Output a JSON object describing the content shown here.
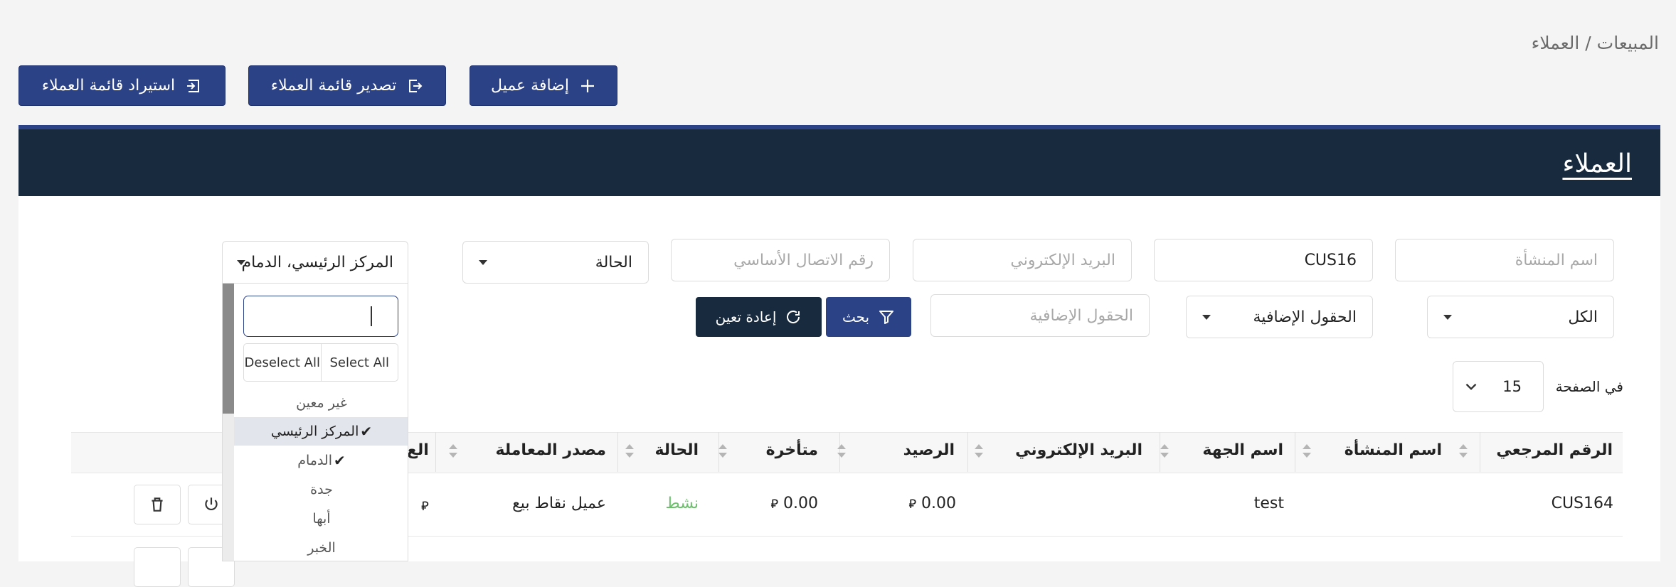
{
  "breadcrumb": {
    "parent": "المبيعات",
    "separator": "/",
    "current": "العملاء"
  },
  "toolbar": {
    "add_label": "إضافة عميل",
    "export_label": "تصدير قائمة العملاء",
    "import_label": "استيراد قائمة العملاء"
  },
  "card": {
    "title": "العملاء"
  },
  "filters": {
    "company_name_placeholder": "اسم المنشأة",
    "reference_value": "CUS16",
    "email_placeholder": "البريد الإلكتروني",
    "phone_placeholder": "رقم الاتصال الأساسي",
    "status_value": "الحالة",
    "branch_value": "المركز الرئيسي، الدمام",
    "all_value": "الكل",
    "extra_fields_select": "الحقول الإضافية",
    "extra_fields_placeholder": "الحقول الإضافية",
    "search_label": "بحث",
    "reset_label": "إعادة تعين"
  },
  "per_page": {
    "label": "في الصفحة",
    "value": "15"
  },
  "table": {
    "headers": [
      "الرقم المرجعي",
      "اسم المنشأة",
      "اسم الجهة",
      "البريد الإلكتروني",
      "الرصيد",
      "متأخرة",
      "الحالة",
      "مصدر المعاملة",
      "الع"
    ],
    "rows": [
      {
        "ref": "CUS164",
        "company": "",
        "contact": "test",
        "email": "",
        "balance": "0.00",
        "overdue": "0.00",
        "status": "نشط",
        "source": "عميل نقاط بيع"
      }
    ],
    "currency_symbol": "⃁"
  },
  "dropdown": {
    "select_all": "Select All",
    "deselect_all": "Deselect All",
    "options": [
      {
        "label": "غير معين",
        "selected": false
      },
      {
        "label": "المركز الرئيسي",
        "selected": true
      },
      {
        "label": "الدمام",
        "selected": true
      },
      {
        "label": "جدة",
        "selected": false
      },
      {
        "label": "أبها",
        "selected": false
      },
      {
        "label": "الخبر",
        "selected": false
      }
    ],
    "check_mark": "✔"
  },
  "colors": {
    "primary": "#2c4286",
    "header_dark": "#182a3e",
    "status_active": "#6cc06c"
  }
}
